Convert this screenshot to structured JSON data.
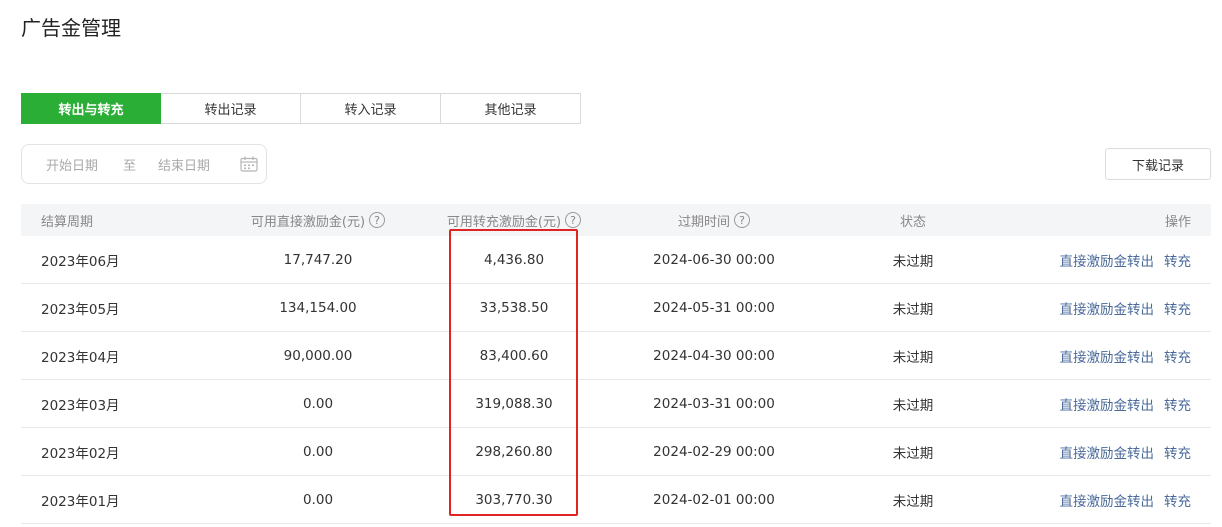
{
  "page": {
    "title": "广告金管理"
  },
  "tabs": [
    {
      "label": "转出与转充",
      "active": true
    },
    {
      "label": "转出记录",
      "active": false
    },
    {
      "label": "转入记录",
      "active": false
    },
    {
      "label": "其他记录",
      "active": false
    }
  ],
  "date_filter": {
    "start_placeholder": "开始日期",
    "separator": "至",
    "end_placeholder": "结束日期"
  },
  "download_button": "下载记录",
  "table": {
    "headers": [
      "结算周期",
      "可用直接激励金(元)",
      "可用转充激励金(元)",
      "过期时间",
      "状态",
      "操作"
    ],
    "help_icon": "?",
    "rows": [
      {
        "period": "2023年06月",
        "direct": "17,747.20",
        "recharge": "4,436.80",
        "expire": "2024-06-30 00:00",
        "status": "未过期",
        "action1": "直接激励金转出",
        "action2": "转充"
      },
      {
        "period": "2023年05月",
        "direct": "134,154.00",
        "recharge": "33,538.50",
        "expire": "2024-05-31 00:00",
        "status": "未过期",
        "action1": "直接激励金转出",
        "action2": "转充"
      },
      {
        "period": "2023年04月",
        "direct": "90,000.00",
        "recharge": "83,400.60",
        "expire": "2024-04-30 00:00",
        "status": "未过期",
        "action1": "直接激励金转出",
        "action2": "转充"
      },
      {
        "period": "2023年03月",
        "direct": "0.00",
        "recharge": "319,088.30",
        "expire": "2024-03-31 00:00",
        "status": "未过期",
        "action1": "直接激励金转出",
        "action2": "转充"
      },
      {
        "period": "2023年02月",
        "direct": "0.00",
        "recharge": "298,260.80",
        "expire": "2024-02-29 00:00",
        "status": "未过期",
        "action1": "直接激励金转出",
        "action2": "转充"
      },
      {
        "period": "2023年01月",
        "direct": "0.00",
        "recharge": "303,770.30",
        "expire": "2024-02-01 00:00",
        "status": "未过期",
        "action1": "直接激励金转出",
        "action2": "转充"
      }
    ]
  },
  "colors": {
    "accent_green": "#2aae35",
    "link_blue": "#4a6a9b",
    "annotation_red": "#e02424"
  }
}
